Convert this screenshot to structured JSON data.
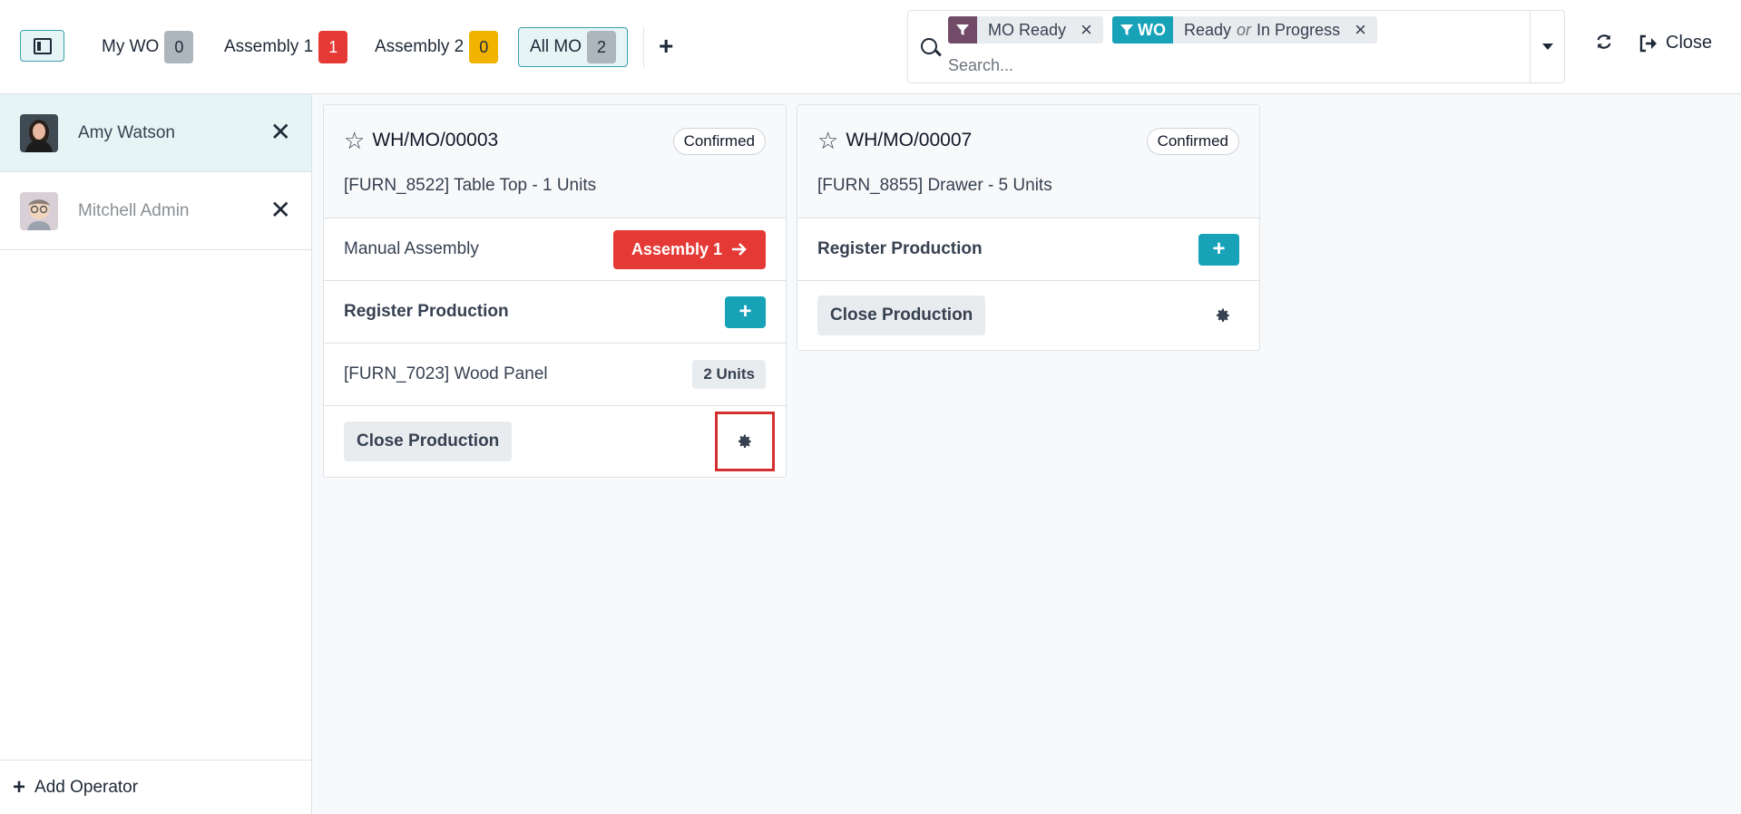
{
  "workcenters": [
    {
      "label": "My WO",
      "count": "0"
    },
    {
      "label": "Assembly 1",
      "count": "1"
    },
    {
      "label": "Assembly 2",
      "count": "0"
    },
    {
      "label": "All MO",
      "count": "2"
    }
  ],
  "search": {
    "facets": [
      {
        "type_label": "",
        "value": "MO Ready"
      },
      {
        "type_label": "WO",
        "value_a": "Ready",
        "or": "or",
        "value_b": "In Progress"
      }
    ],
    "placeholder": "Search..."
  },
  "header": {
    "close_label": "Close"
  },
  "operators": [
    {
      "name": "Amy Watson",
      "active": true
    },
    {
      "name": "Mitchell Admin",
      "active": false
    }
  ],
  "add_operator_label": "Add Operator",
  "cards": [
    {
      "reference": "WH/MO/00003",
      "state": "Confirmed",
      "product": "[FURN_8522] Table Top - 1 Units",
      "operation": {
        "name": "Manual Assembly",
        "workcenter_button": "Assembly 1"
      },
      "register_label": "Register Production",
      "component": {
        "name": "[FURN_7023] Wood Panel",
        "qty": "2 Units"
      },
      "close_label": "Close Production"
    },
    {
      "reference": "WH/MO/00007",
      "state": "Confirmed",
      "product": "[FURN_8855] Drawer - 5 Units",
      "register_label": "Register Production",
      "close_label": "Close Production"
    }
  ],
  "colors": {
    "accent": "#17a2b8",
    "danger": "#e53935",
    "warning": "#f0b400",
    "mo_facet": "#714b67"
  }
}
